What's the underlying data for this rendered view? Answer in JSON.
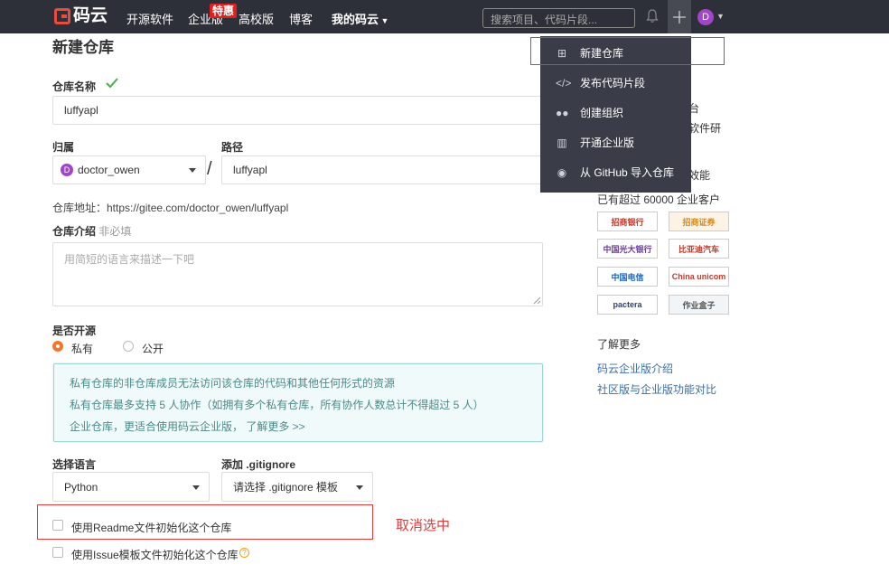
{
  "nav": {
    "logo_text": "码云",
    "links": [
      "开源软件",
      "企业版",
      "高校版",
      "博客",
      "我的码云"
    ],
    "badge": "特惠",
    "search_placeholder": "搜索项目、代码片段...",
    "avatar_letter": "D"
  },
  "dropdown": {
    "items": [
      "新建仓库",
      "发布代码片段",
      "创建组织",
      "开通企业版",
      "从 GitHub 导入仓库"
    ]
  },
  "form": {
    "title": "新建仓库",
    "name_label": "仓库名称",
    "name_value": "luffyapl",
    "owner_label": "归属",
    "owner_value": "doctor_owen",
    "owner_avatar": "D",
    "path_label": "路径",
    "path_value": "luffyapl",
    "separator": "/",
    "address": "仓库地址：https://gitee.com/doctor_owen/luffyapl",
    "intro_label": "仓库介绍",
    "intro_optional": "非必填",
    "intro_placeholder": "用简短的语言来描述一下吧",
    "open_label": "是否开源",
    "private_label": "私有",
    "public_label": "公开",
    "notice": [
      "私有仓库的非仓库成员无法访问该仓库的代码和其他任何形式的资源",
      "私有仓库最多支持 5 人协作（如拥有多个私有仓库，所有协作人数总计不得超过 5 人）",
      "企业仓库，更适合使用码云企业版， 了解更多 >>"
    ],
    "lang_label": "选择语言",
    "lang_value": "Python",
    "gitignore_label": "添加 .gitignore",
    "gitignore_value": "请选择 .gitignore 模板",
    "readme_label": "使用Readme文件初始化这个仓库",
    "issue_label": "使用Issue模板文件初始化这个仓库",
    "annotation": "取消选中"
  },
  "right": {
    "partial1": "台",
    "partial2": "软件研",
    "partial3": "效能",
    "customers": "已有超过 60000 企业客户",
    "logos": [
      "招商银行",
      "招商证券",
      "中国光大银行",
      "比亚迪汽车",
      "中国电信",
      "China unicom",
      "pactera",
      "作业盒子"
    ],
    "more_title": "了解更多",
    "link1": "码云企业版介绍",
    "link2": "社区版与企业版功能对比"
  },
  "colors": {
    "nav_bg": "#2d3038",
    "dropdown_bg": "#3a3d47",
    "accent_orange": "#f0772c",
    "annotation_red": "#e03b3b",
    "check_green": "#4caf50"
  }
}
